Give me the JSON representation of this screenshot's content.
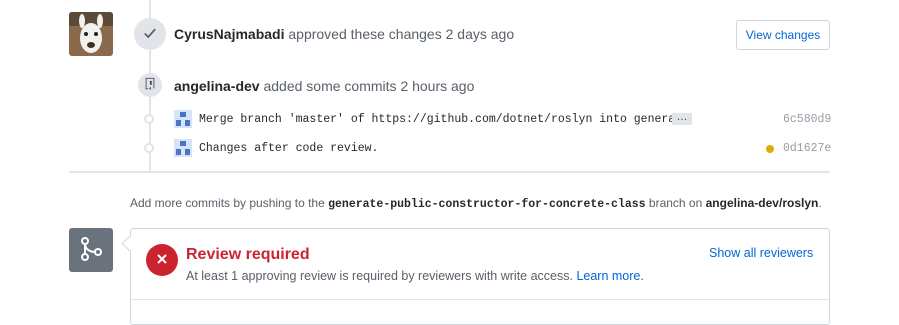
{
  "review_event": {
    "author": "CyrusNajmabadi",
    "action": "approved these changes",
    "time": "2 days ago",
    "view_changes_label": "View changes",
    "icon": "check-icon"
  },
  "commits_event": {
    "author": "angelina-dev",
    "action": "added some commits",
    "time": "2 hours ago",
    "icon": "repo-push-icon",
    "commits": [
      {
        "message": "Merge branch 'master' of https://github.com/dotnet/roslyn into genera…",
        "ellipsis": "…",
        "sha": "6c580d9",
        "status": ""
      },
      {
        "message": "Changes after code review.",
        "ellipsis": "",
        "sha": "0d1627e",
        "status": "pending"
      }
    ]
  },
  "hint": {
    "prefix": "Add more commits by pushing to the",
    "branch": "generate-public-constructor-for-concrete-class",
    "middle": "branch on",
    "repo": "angelina-dev/roslyn",
    "suffix": "."
  },
  "merge_box": {
    "title": "Review required",
    "subtitle": "At least 1 approving review is required by reviewers with write access.",
    "learn_more": "Learn more.",
    "show_reviewers": "Show all reviewers",
    "status_color": "#cb2431"
  }
}
